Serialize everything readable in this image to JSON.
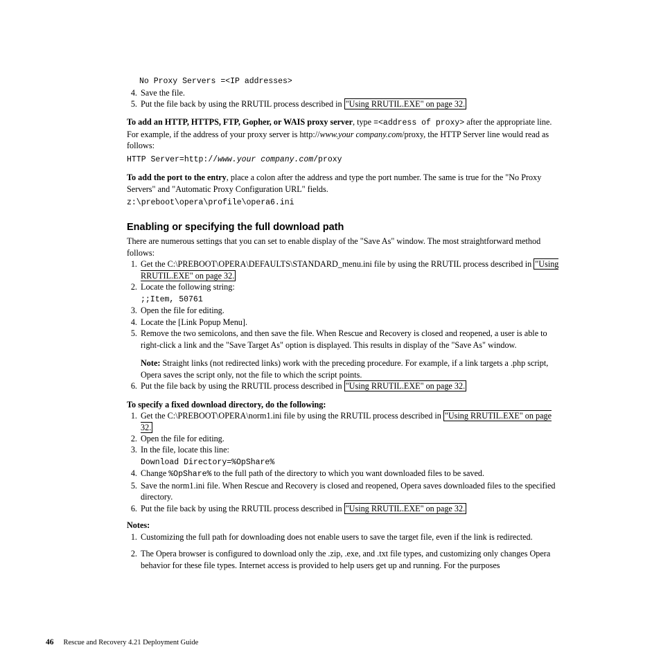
{
  "code1": "No Proxy Servers =<IP addresses>",
  "step4a": "Save the file.",
  "step5a_a": "Put the file back by using the RRUTIL process described in ",
  "link_rrutil_a": "\"Using RRUTIL.EXE\" on page 32.",
  "para1_bold": "To add an HTTP, HTTPS, FTP, Gopher, or WAIS proxy server",
  "para1_a": ", type ",
  "para1_code1": "=<address of proxy>",
  "para1_b": " after the appropriate line. For example, if the address of your proxy server is http://",
  "para1_i": "www.your company.com",
  "para1_c": "/proxy, the HTTP Server line would read as follows:",
  "code2a": "HTTP Server=http://",
  "code2b": "www.your company.com",
  "code2c": "/proxy",
  "para2_bold": "To add the port to the entry",
  "para2_a": ", place a colon after the address and type the port number. The same is true for the \"No Proxy Servers\" and \"Automatic Proxy Configuration URL\" fields.",
  "code3": "z:\\preboot\\opera\\profile\\opera6.ini",
  "h2": "Enabling or specifying the full download path",
  "para3": "There are numerous settings that you can set to enable display of the \"Save As\" window. The most straightforward method follows:",
  "s2_1a": "Get the C:\\PREBOOT\\OPERA\\DEFAULTS\\STANDARD_menu.ini file by using the RRUTIL process described in ",
  "link_rrutil_b": "\"Using RRUTIL.EXE\" on page 32.",
  "s2_2": "Locate the following string:",
  "code4": ";;Item, 50761",
  "s2_3": "Open the file for editing.",
  "s2_4": "Locate the [Link Popup Menu].",
  "s2_5": "Remove the two semicolons, and then save the file. When Rescue and Recovery is closed and reopened, a user is able to right-click a link and the \"Save Target As\" option is displayed. This results in display of the \"Save As\" window.",
  "note_bold": "Note:",
  "note_body": " Straight links (not redirected links) work with the preceding procedure. For example, if a link targets a .php script, Opera saves the script only, not the file to which the script points.",
  "s2_6a": "Put the file back by using the RRUTIL process described in ",
  "link_rrutil_c": "\"Using RRUTIL.EXE\" on page 32.",
  "para4_bold": "To specify a fixed download directory, do the following:",
  "s3_1a": "Get the C:\\PREBOOT\\OPERA\\norm1.ini file by using the RRUTIL process described in ",
  "link_rrutil_d": "\"Using RRUTIL.EXE\" on page 32.",
  "s3_2": "Open the file for editing.",
  "s3_3": "In the file, locate this line:",
  "code5": "Download Directory=%OpShare%",
  "s3_4a": "Change ",
  "s3_4code": "%OpShare%",
  "s3_4b": " to the full path of the directory to which you want downloaded files to be saved.",
  "s3_5": "Save the norm1.ini file. When Rescue and Recovery is closed and reopened, Opera saves downloaded files to the specified directory.",
  "s3_6a": "Put the file back by using the RRUTIL process described in ",
  "link_rrutil_e": "\"Using RRUTIL.EXE\" on page 32.",
  "notes_label": "Notes:",
  "n1": "Customizing the full path for downloading does not enable users to save the target file, even if the link is redirected.",
  "n2": "The Opera browser is configured to download only the .zip, .exe, and .txt file types, and customizing only changes Opera behavior for these file types. Internet access is provided to help users get up and running. For the purposes",
  "footer_page": "46",
  "footer_text": "Rescue and Recovery 4.21 Deployment Guide"
}
